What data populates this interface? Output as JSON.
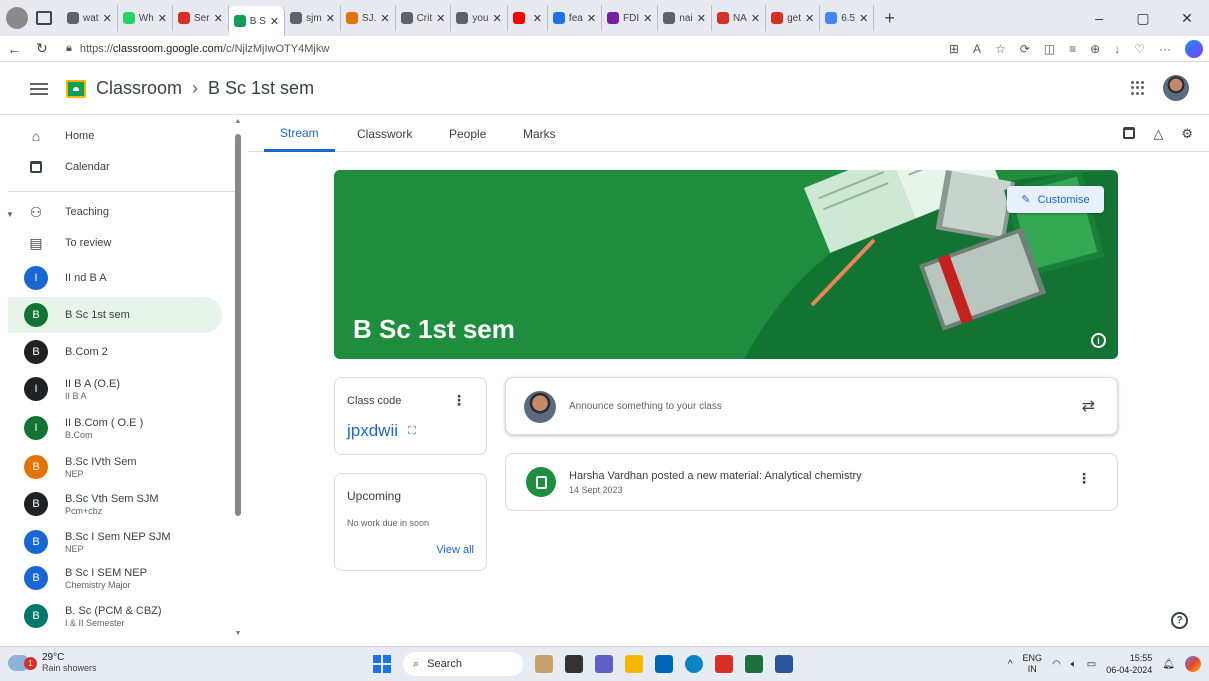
{
  "browser": {
    "tabs": [
      {
        "title": "wat",
        "color": "#5f6368"
      },
      {
        "title": "Wh",
        "color": "#25d366"
      },
      {
        "title": "Ser",
        "color": "#d93025"
      },
      {
        "title": "B S",
        "color": "#0f9d58",
        "active": true
      },
      {
        "title": "sjm",
        "color": "#5f6368"
      },
      {
        "title": "SJ.",
        "color": "#e37400"
      },
      {
        "title": "Crit",
        "color": "#5f6368"
      },
      {
        "title": "you",
        "color": "#5f6368"
      },
      {
        "title": "",
        "color": "#ff0000"
      },
      {
        "title": "fea",
        "color": "#1a73e8"
      },
      {
        "title": "FDI",
        "color": "#7b1fa2"
      },
      {
        "title": "nai",
        "color": "#5f6368"
      },
      {
        "title": "NA",
        "color": "#d93025"
      },
      {
        "title": "get",
        "color": "#d93025"
      },
      {
        "title": "6.5",
        "color": "#4285f4"
      }
    ],
    "url_prefix": "https://",
    "url_domain": "classroom.google.com",
    "url_path": "/c/NjlzMjIwOTY4Mjkw"
  },
  "header": {
    "app_name": "Classroom",
    "separator": "›",
    "class_name": "B Sc 1st sem"
  },
  "sidebar": {
    "home": "Home",
    "calendar": "Calendar",
    "teaching": "Teaching",
    "to_review": "To review",
    "classes": [
      {
        "initial": "I",
        "name": "II nd B A",
        "sub": "",
        "color": "#1967d2"
      },
      {
        "initial": "B",
        "name": "B Sc 1st sem",
        "sub": "",
        "color": "#137333",
        "selected": true
      },
      {
        "initial": "B",
        "name": "B.Com 2",
        "sub": "",
        "color": "#202124"
      },
      {
        "initial": "I",
        "name": "II B A (O.E)",
        "sub": "II B A",
        "color": "#202124"
      },
      {
        "initial": "I",
        "name": "II B.Com ( O.E )",
        "sub": "B.Com",
        "color": "#137333"
      },
      {
        "initial": "B",
        "name": "B.Sc IVth Sem",
        "sub": "NEP",
        "color": "#e37400"
      },
      {
        "initial": "B",
        "name": "B.Sc Vth Sem SJM",
        "sub": "Pcm+cbz",
        "color": "#202124"
      },
      {
        "initial": "B",
        "name": "B.Sc I Sem NEP SJM",
        "sub": "NEP",
        "color": "#1967d2"
      },
      {
        "initial": "B",
        "name": "B Sc I SEM NEP",
        "sub": "Chemistry Major",
        "color": "#1967d2"
      },
      {
        "initial": "B",
        "name": "B. Sc (PCM & CBZ)",
        "sub": "I & II Semester",
        "color": "#00796b"
      }
    ]
  },
  "tabs": [
    "Stream",
    "Classwork",
    "People",
    "Marks"
  ],
  "banner": {
    "title": "B Sc 1st sem",
    "customise_label": "Customise",
    "info": "i"
  },
  "class_code": {
    "label": "Class code",
    "code": "jpxdwii"
  },
  "upcoming": {
    "title": "Upcoming",
    "empty": "No work due in soon",
    "view_all": "View all"
  },
  "announce": {
    "placeholder": "Announce something to your class"
  },
  "post": {
    "title": "Harsha Vardhan posted a new material: Analytical chemistry",
    "date": "14 Sept 2023"
  },
  "taskbar": {
    "weather_temp": "29°C",
    "weather_desc": "Rain showers",
    "weather_badge": "1",
    "search": "Search",
    "lang": "ENG",
    "region": "IN",
    "time": "15:55",
    "date": "06-04-2024"
  }
}
